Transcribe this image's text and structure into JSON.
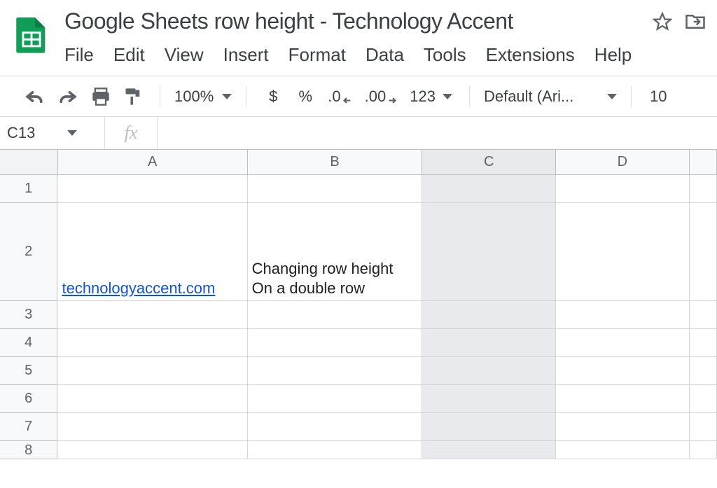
{
  "doc": {
    "title": "Google Sheets row height - Technology Accent"
  },
  "menu": {
    "file": "File",
    "edit": "Edit",
    "view": "View",
    "insert": "Insert",
    "format": "Format",
    "data": "Data",
    "tools": "Tools",
    "extensions": "Extensions",
    "help": "Help"
  },
  "toolbar": {
    "zoom": "100%",
    "currency": "$",
    "percent": "%",
    "dec_decrease": ".0",
    "dec_increase": ".00",
    "numfmt": "123",
    "font": "Default (Ari...",
    "fontsize": "10"
  },
  "formula": {
    "namebox": "C13",
    "fx": "fx",
    "value": ""
  },
  "columns": [
    "A",
    "B",
    "C",
    "D"
  ],
  "rows": [
    "1",
    "2",
    "3",
    "4",
    "5",
    "6",
    "7",
    "8"
  ],
  "cells": {
    "A2": "technologyaccent.com",
    "B2": "Changing row height\nOn a double row"
  }
}
